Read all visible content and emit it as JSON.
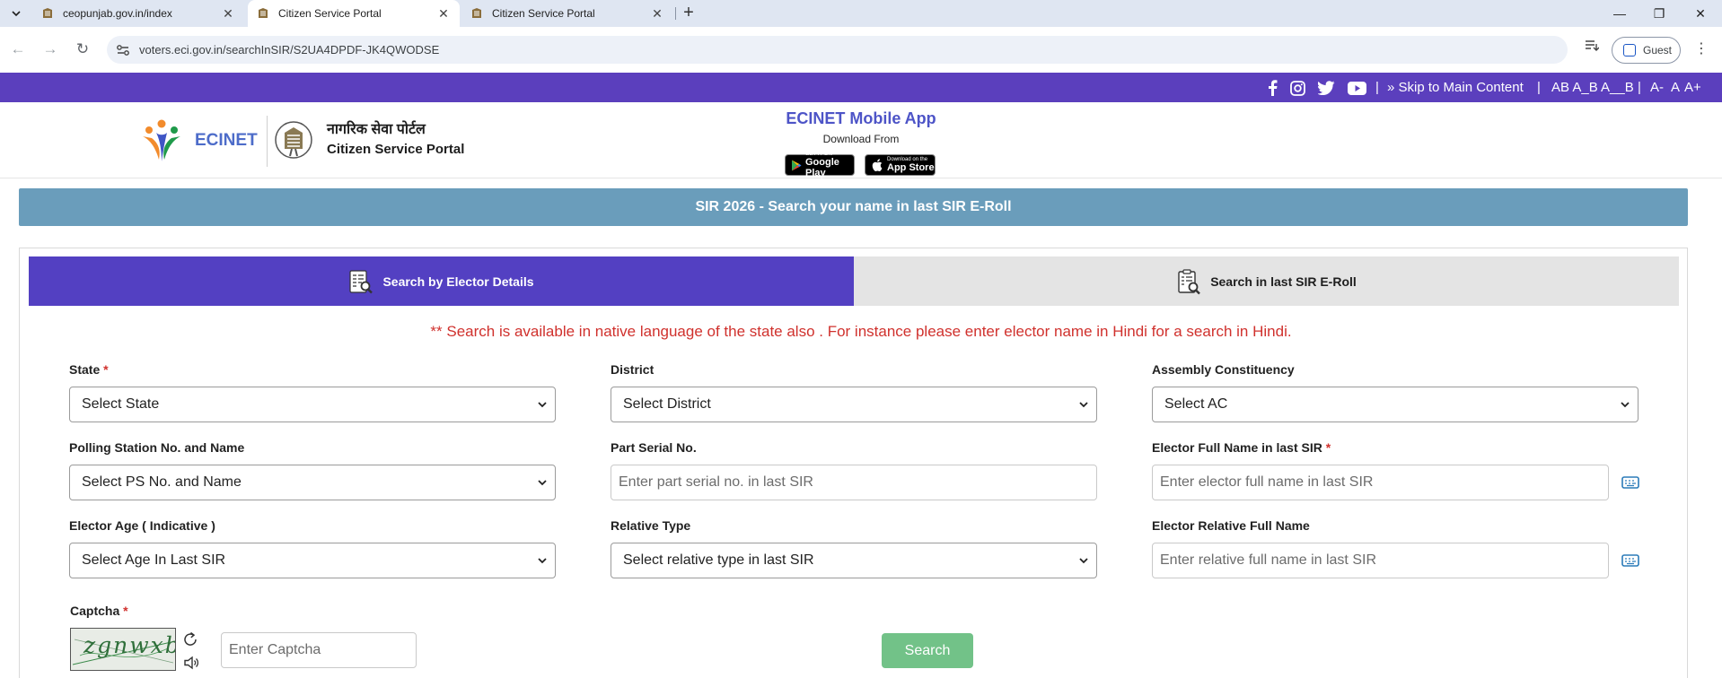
{
  "browser": {
    "tabs": [
      {
        "title": "ceopunjab.gov.in/index",
        "active": false
      },
      {
        "title": "Citizen Service Portal",
        "active": true
      },
      {
        "title": "Citizen Service Portal",
        "active": false
      }
    ],
    "url": "voters.eci.gov.in/searchInSIR/S2UA4DPDF-JK4QWODSE",
    "profile_label": "Guest"
  },
  "topbar": {
    "skip_link": "» Skip to Main Content",
    "text_sizes": "AB A_B A__B",
    "font_sizes": [
      "A-",
      "A",
      "A+"
    ],
    "separator": "|",
    "social_icons": [
      "facebook-icon",
      "instagram-icon",
      "twitter-icon",
      "youtube-icon"
    ],
    "color": "#5b3fbd"
  },
  "header": {
    "brand": "ECINET",
    "portal_hindi": "नागरिक सेवा पोर्टल",
    "portal_english": "Citizen Service Portal",
    "app_title": "ECINET Mobile App",
    "download_from": "Download From",
    "google_play_small": "GET IT ON",
    "google_play": "Google Play",
    "app_store_small": "Download on the",
    "app_store": "App Store"
  },
  "title_bar": "SIR 2026 - Search your name in last SIR E-Roll",
  "tabs": {
    "elector_details": "Search by Elector Details",
    "eroll": "Search in last SIR E-Roll",
    "active_color": "#5340c2"
  },
  "notice": "** Search is available in native language of the state also . For instance please enter elector name in Hindi for a search in Hindi.",
  "form": {
    "state": {
      "label": "State",
      "value": "Select State"
    },
    "district": {
      "label": "District",
      "value": "Select District"
    },
    "ac": {
      "label": "Assembly Constituency",
      "value": "Select AC"
    },
    "ps": {
      "label": "Polling Station No. and Name",
      "value": "Select PS No. and Name"
    },
    "part": {
      "label": "Part Serial No.",
      "placeholder": "Enter part serial no. in last SIR"
    },
    "elector_name": {
      "label": "Elector Full Name in last SIR",
      "placeholder": "Enter elector full name in last SIR"
    },
    "age": {
      "label": "Elector Age ( Indicative )",
      "value": "Select Age In Last SIR"
    },
    "relative_type": {
      "label": "Relative Type",
      "value": "Select relative type in last SIR"
    },
    "relative_name": {
      "label": "Elector Relative Full Name",
      "placeholder": "Enter relative full name in last SIR"
    },
    "captcha": {
      "label": "Captcha",
      "image_text": "zgnwxb",
      "placeholder": "Enter Captcha"
    },
    "required_mark": "*",
    "search_button": "Search"
  }
}
